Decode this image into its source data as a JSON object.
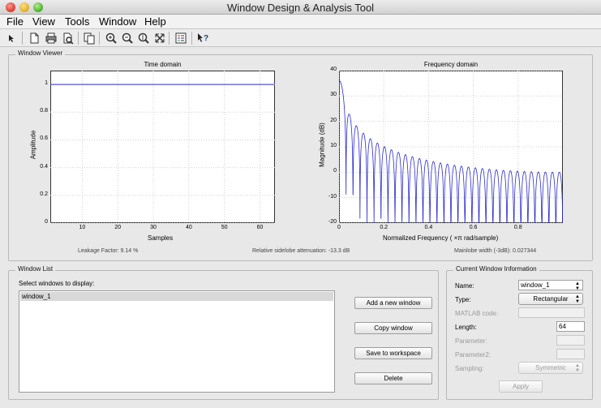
{
  "window": {
    "title": "Window Design & Analysis Tool"
  },
  "menu": [
    "File",
    "View",
    "Tools",
    "Window",
    "Help"
  ],
  "toolbar_icons": [
    "pointer-icon",
    "new-document-icon",
    "print-icon",
    "print-preview-icon",
    "copy-figure-icon",
    "zoom-in-icon",
    "zoom-out-icon",
    "zoom-y-icon",
    "full-view-icon",
    "legend-icon",
    "whats-this-icon"
  ],
  "viewer": {
    "title": "Window Viewer",
    "time": {
      "title": "Time domain",
      "xlabel": "Samples",
      "ylabel": "Amplitude",
      "yticks": [
        "0",
        "0.2",
        "0.4",
        "0.6",
        "0.8",
        "1"
      ],
      "xticks": [
        "10",
        "20",
        "30",
        "40",
        "50",
        "60"
      ]
    },
    "freq": {
      "title": "Frequency domain",
      "xlabel": "Normalized Frequency (  ×π rad/sample)",
      "ylabel": "Magnitude (dB)",
      "yticks": [
        "-20",
        "-10",
        "0",
        "10",
        "20",
        "30",
        "40"
      ],
      "xticks": [
        "0",
        "0.2",
        "0.4",
        "0.6",
        "0.8"
      ]
    },
    "leakage": "Leakage Factor: 9.14 %",
    "sidelobe": "Relative sidelobe attenuation: -13.3 dB",
    "mainlobe": "Mainlobe width (-3dB): 0.027344",
    "line_color": "#2b2bcc"
  },
  "winlist": {
    "title": "Window List",
    "prompt": "Select windows to display:",
    "items": [
      "window_1"
    ],
    "buttons": {
      "add": "Add a new window",
      "copy": "Copy window",
      "save": "Save to workspace",
      "delete": "Delete"
    }
  },
  "current": {
    "title": "Current Window Information",
    "name_label": "Name:",
    "name_value": "window_1",
    "type_label": "Type:",
    "type_value": "Rectangular",
    "matlab_label": "MATLAB code:",
    "length_label": "Length:",
    "length_value": "64",
    "param_label": "Parameter:",
    "param2_label": "Parameter2:",
    "sampling_label": "Sampling:",
    "sampling_value": "Symmetric",
    "apply": "Apply"
  }
}
